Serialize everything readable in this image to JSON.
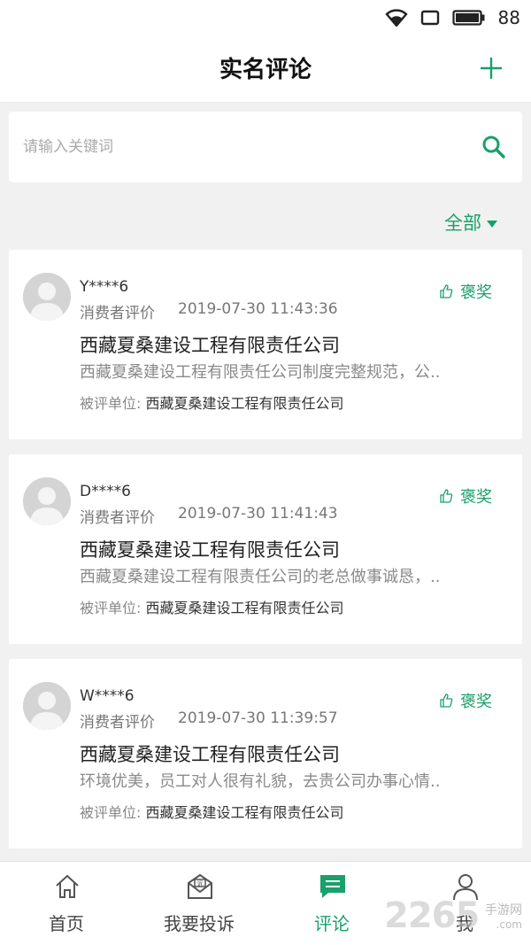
{
  "status_bar": {
    "battery": "88"
  },
  "header": {
    "title": "实名评论"
  },
  "search": {
    "placeholder": "请输入关键词"
  },
  "filter": {
    "label": "全部"
  },
  "colors": {
    "accent": "#1aa06a"
  },
  "reviews": [
    {
      "user": "Y****6",
      "role": "消费者评价",
      "time": "2019-07-30 11:43:36",
      "badge": "褒奖",
      "company": "西藏夏桑建设工程有限责任公司",
      "content": "西藏夏桑建设工程有限责任公司制度完整规范，公..",
      "unit_label": "被评单位:",
      "unit_value": "西藏夏桑建设工程有限责任公司"
    },
    {
      "user": "D****6",
      "role": "消费者评价",
      "time": "2019-07-30 11:41:43",
      "badge": "褒奖",
      "company": "西藏夏桑建设工程有限责任公司",
      "content": "西藏夏桑建设工程有限责任公司的老总做事诚恳，..",
      "unit_label": "被评单位:",
      "unit_value": "西藏夏桑建设工程有限责任公司"
    },
    {
      "user": "W****6",
      "role": "消费者评价",
      "time": "2019-07-30 11:39:57",
      "badge": "褒奖",
      "company": "西藏夏桑建设工程有限责任公司",
      "content": "环境优美，员工对人很有礼貌，去贵公司办事心情..",
      "unit_label": "被评单位:",
      "unit_value": "西藏夏桑建设工程有限责任公司"
    }
  ],
  "tabbar": {
    "items": [
      {
        "label": "首页",
        "icon": "home-icon"
      },
      {
        "label": "我要投诉",
        "icon": "complaint-icon"
      },
      {
        "label": "评论",
        "icon": "comment-icon",
        "active": true
      },
      {
        "label": "我",
        "icon": "user-icon"
      }
    ]
  },
  "watermark": {
    "number": "2265",
    "site": "手游网",
    "url": ".com"
  }
}
